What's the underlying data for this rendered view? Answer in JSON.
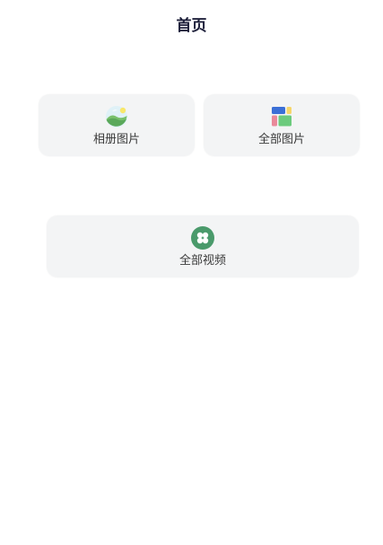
{
  "header": {
    "title": "首页"
  },
  "cards": [
    {
      "label": "相册图片",
      "icon": "landscape-photo-icon"
    },
    {
      "label": "全部图片",
      "icon": "color-grid-icon"
    },
    {
      "label": "全部视频",
      "icon": "four-petal-icon"
    }
  ],
  "colors": {
    "card_background": "#f3f4f5",
    "title": "#1d1f3a",
    "video_icon": "#4a9a6b"
  }
}
